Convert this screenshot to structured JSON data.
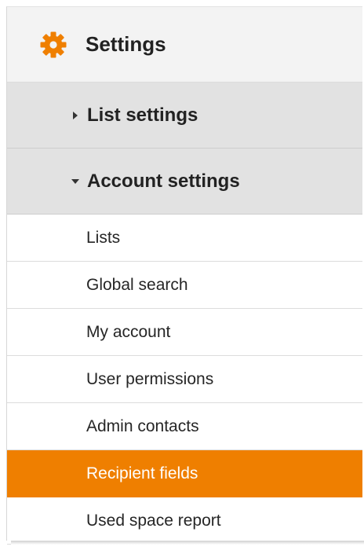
{
  "header": {
    "title": "Settings",
    "icon": "gear-icon",
    "icon_color": "#ef7f00"
  },
  "sections": [
    {
      "label": "List settings",
      "expanded": false,
      "arrow_icon": "triangle-right-icon"
    },
    {
      "label": "Account settings",
      "expanded": true,
      "arrow_icon": "triangle-down-icon"
    }
  ],
  "account_items": [
    {
      "label": "Lists",
      "active": false
    },
    {
      "label": "Global search",
      "active": false
    },
    {
      "label": "My account",
      "active": false
    },
    {
      "label": "User permissions",
      "active": false
    },
    {
      "label": "Admin contacts",
      "active": false
    },
    {
      "label": "Recipient fields",
      "active": true
    },
    {
      "label": "Used space report",
      "active": false
    }
  ],
  "colors": {
    "accent": "#ef7f00",
    "section_bg": "#e2e2e2",
    "header_bg": "#f3f3f3"
  }
}
